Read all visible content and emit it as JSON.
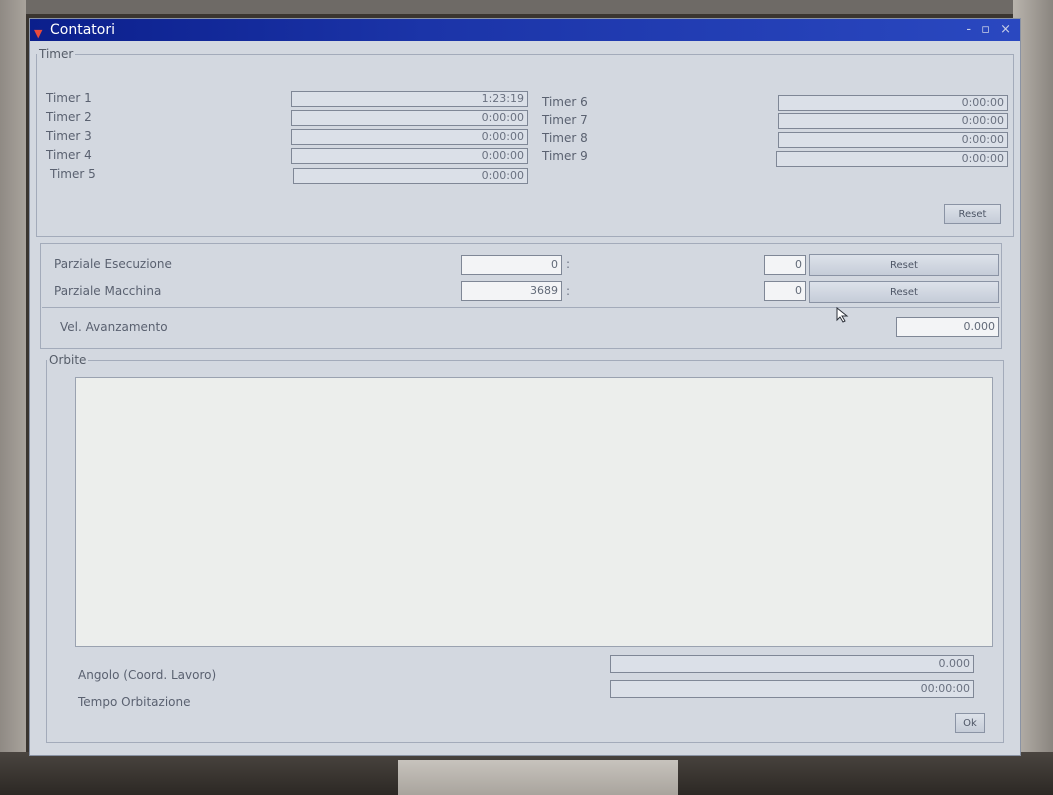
{
  "window": {
    "title": "Contatori",
    "controls": "- ▫ ×"
  },
  "timer_group": {
    "legend": "Timer",
    "timers_left": [
      {
        "label": "Timer 1",
        "value": "1:23:19"
      },
      {
        "label": "Timer 2",
        "value": "0:00:00"
      },
      {
        "label": "Timer 3",
        "value": "0:00:00"
      },
      {
        "label": "Timer 4",
        "value": "0:00:00"
      },
      {
        "label": "Timer 5",
        "value": "0:00:00"
      }
    ],
    "timers_right": [
      {
        "label": "Timer 6",
        "value": "0:00:00"
      },
      {
        "label": "Timer 7",
        "value": "0:00:00"
      },
      {
        "label": "Timer 8",
        "value": "0:00:00"
      },
      {
        "label": "Timer 9",
        "value": "0:00:00"
      }
    ],
    "reset_label": "Reset"
  },
  "counters": {
    "rows": [
      {
        "label": "Parziale Esecuzione",
        "value": "0",
        "colon": ":",
        "second_value": "0",
        "reset_label": "Reset"
      },
      {
        "label": "Parziale Macchina",
        "value": "3689",
        "colon": ":",
        "second_value": "0",
        "reset_label": "Reset"
      }
    ],
    "feed": {
      "label": "Vel. Avanzamento",
      "value": "0.000"
    }
  },
  "orbite_group": {
    "legend": "Orbite",
    "angle": {
      "label": "Angolo (Coord. Lavoro)",
      "value": "0.000"
    },
    "time": {
      "label": "Tempo Orbitazione",
      "value": "00:00:00"
    },
    "ok_label": "Ok"
  }
}
